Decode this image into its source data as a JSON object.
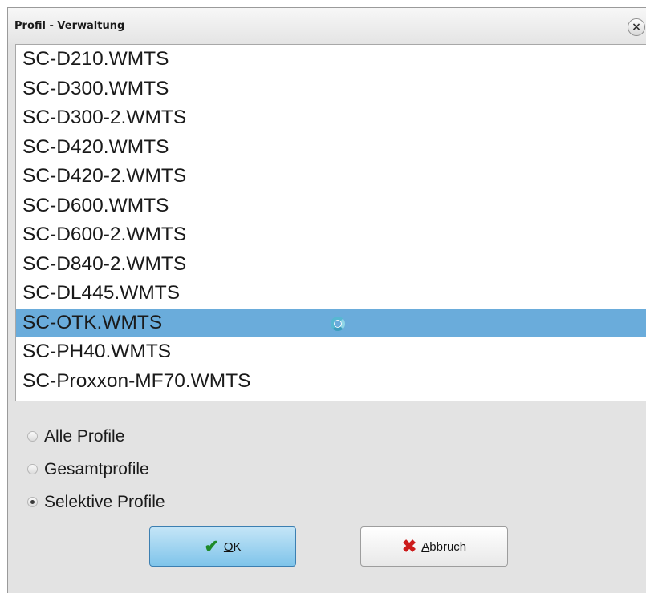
{
  "window": {
    "title": "Profil - Verwaltung",
    "close_glyph": "×"
  },
  "profiles": [
    "SC-D210.WMTS",
    "SC-D300.WMTS",
    "SC-D300-2.WMTS",
    "SC-D420.WMTS",
    "SC-D420-2.WMTS",
    "SC-D600.WMTS",
    "SC-D600-2.WMTS",
    "SC-D840-2.WMTS",
    "SC-DL445.WMTS",
    "SC-OTK.WMTS",
    "SC-PH40.WMTS",
    "SC-Proxxon-MF70.WMTS"
  ],
  "selected_profile": "SC-OTK.WMTS",
  "filter": {
    "options": [
      "Alle Profile",
      "Gesamtprofile",
      "Selektive Profile"
    ],
    "selected": "Selektive Profile"
  },
  "buttons": {
    "ok_label": "OK",
    "cancel_label": "Abbruch",
    "ok_icon": "check-icon",
    "cancel_icon": "x-icon"
  },
  "colors": {
    "selection": "#6aacdb",
    "ok_button": "#7fc4ea",
    "check": "#1e8a2a",
    "cancel_x": "#cc1b1b"
  }
}
